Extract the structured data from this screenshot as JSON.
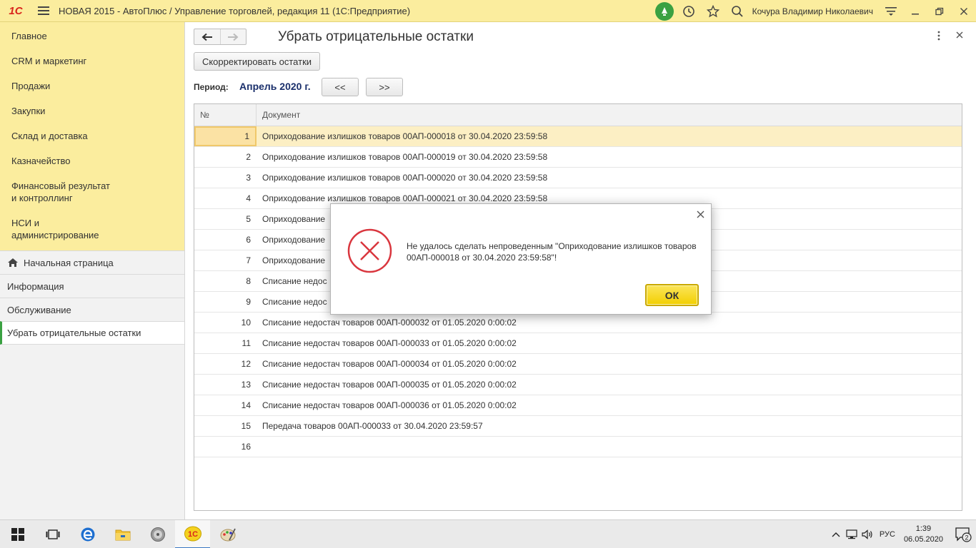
{
  "titlebar": {
    "logo": "1С",
    "title": "НОВАЯ 2015 - АвтоПлюс / Управление торговлей, редакция 11  (1С:Предприятие)",
    "user": "Кочура Владимир Николаевич"
  },
  "sidebar": {
    "sections": [
      {
        "label": "Главное"
      },
      {
        "label": "CRM и маркетинг"
      },
      {
        "label": "Продажи"
      },
      {
        "label": "Закупки"
      },
      {
        "label": "Склад и доставка"
      },
      {
        "label": "Казначейство"
      },
      {
        "label": "Финансовый результат и контроллинг"
      },
      {
        "label": "НСИ и администрирование"
      }
    ],
    "nav": {
      "home": "Начальная страница",
      "info": "Информация",
      "service": "Обслуживание",
      "current": "Убрать отрицательные остатки"
    }
  },
  "form": {
    "title": "Убрать отрицательные остатки",
    "correct_button": "Скорректировать остатки",
    "period_label": "Период:",
    "period_value": "Апрель 2020 г.",
    "prev_button": "<<",
    "next_button": ">>"
  },
  "table": {
    "headers": {
      "num": "№",
      "doc": "Документ"
    },
    "rows": [
      {
        "num": "1",
        "doc": "Оприходование излишков товаров 00АП-000018 от 30.04.2020 23:59:58"
      },
      {
        "num": "2",
        "doc": "Оприходование излишков товаров 00АП-000019 от 30.04.2020 23:59:58"
      },
      {
        "num": "3",
        "doc": "Оприходование излишков товаров 00АП-000020 от 30.04.2020 23:59:58"
      },
      {
        "num": "4",
        "doc": "Оприходование излишков товаров 00АП-000021 от 30.04.2020 23:59:58"
      },
      {
        "num": "5",
        "doc": "Оприходование"
      },
      {
        "num": "6",
        "doc": "Оприходование"
      },
      {
        "num": "7",
        "doc": "Оприходование"
      },
      {
        "num": "8",
        "doc": "Списание недос"
      },
      {
        "num": "9",
        "doc": "Списание недос"
      },
      {
        "num": "10",
        "doc": "Списание недостач товаров 00АП-000032 от 01.05.2020 0:00:02"
      },
      {
        "num": "11",
        "doc": "Списание недостач товаров 00АП-000033 от 01.05.2020 0:00:02"
      },
      {
        "num": "12",
        "doc": "Списание недостач товаров 00АП-000034 от 01.05.2020 0:00:02"
      },
      {
        "num": "13",
        "doc": "Списание недостач товаров 00АП-000035 от 01.05.2020 0:00:02"
      },
      {
        "num": "14",
        "doc": "Списание недостач товаров 00АП-000036 от 01.05.2020 0:00:02"
      },
      {
        "num": "15",
        "doc": "Передача товаров 00АП-000033 от 30.04.2020 23:59:57"
      },
      {
        "num": "16",
        "doc": ""
      }
    ]
  },
  "dialog": {
    "message": "Не удалось сделать непроведенным \"Оприходование излишков товаров 00АП-000018 от 30.04.2020 23:59:58\"!",
    "ok_button": "ОК"
  },
  "taskbar": {
    "lang": "РУС",
    "time": "1:39",
    "date": "06.05.2020",
    "notifications": "2"
  },
  "colors": {
    "sections_bg": "#fbed9e",
    "accent_green": "#3aa142",
    "selected_row": "#fcefc4",
    "ok_button": "#f2cf00",
    "error_red": "#d9363e"
  }
}
